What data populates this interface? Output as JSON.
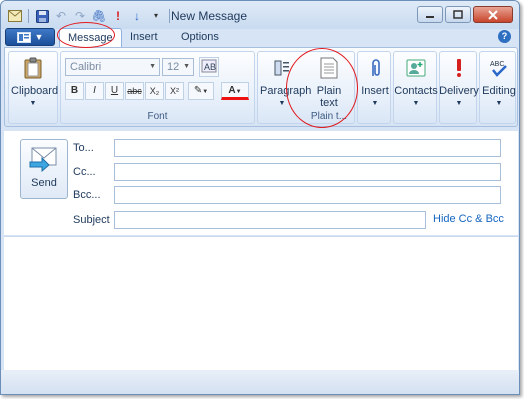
{
  "window": {
    "title": "New Message"
  },
  "tabs": [
    "Message",
    "Insert",
    "Options"
  ],
  "help_label": "?",
  "ribbon": {
    "clipboard": {
      "label": "Clipboard"
    },
    "font": {
      "group_label": "Font",
      "family": "Calibri",
      "size": "12",
      "buttons": [
        "B",
        "I",
        "U",
        "abc",
        "X₂",
        "X²"
      ]
    },
    "paragraph": {
      "label": "Paragraph"
    },
    "plaintext": {
      "label_line1": "Plain",
      "label_line2": "text",
      "group_label": "Plain t..."
    },
    "insert": {
      "label": "Insert"
    },
    "contacts": {
      "label": "Contacts"
    },
    "delivery": {
      "label": "Delivery"
    },
    "editing": {
      "label": "Editing"
    }
  },
  "compose": {
    "send_label": "Send",
    "to_label": "To...",
    "cc_label": "Cc...",
    "bcc_label": "Bcc...",
    "subject_label": "Subject",
    "hide_cc_label": "Hide Cc & Bcc",
    "to_value": "",
    "cc_value": "",
    "bcc_value": "",
    "subject_value": ""
  },
  "colors": {
    "accent": "#1565c0",
    "annotation": "#e2191d"
  }
}
